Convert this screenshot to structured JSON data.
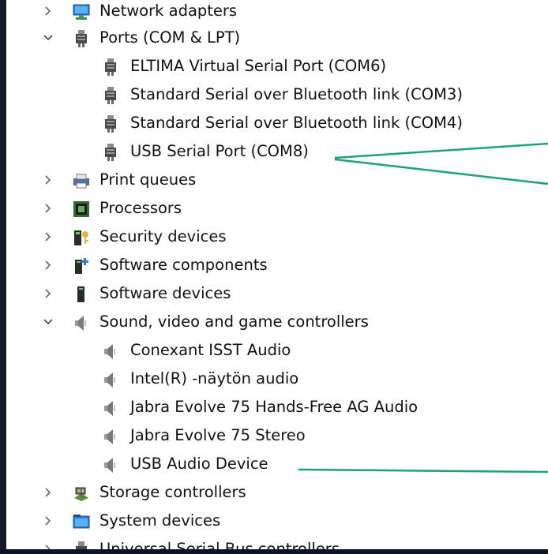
{
  "tree": {
    "items": [
      {
        "label": "Network adapters",
        "level": 0,
        "state": "collapsed",
        "icon": "network-adapter-icon"
      },
      {
        "label": "Ports (COM & LPT)",
        "level": 0,
        "state": "expanded",
        "icon": "port-icon"
      },
      {
        "label": "ELTIMA Virtual Serial Port (COM6)",
        "level": 1,
        "icon": "port-icon"
      },
      {
        "label": "Standard Serial over Bluetooth link (COM3)",
        "level": 1,
        "icon": "port-icon"
      },
      {
        "label": "Standard Serial over Bluetooth link (COM4)",
        "level": 1,
        "icon": "port-icon"
      },
      {
        "label": "USB Serial Port (COM8)",
        "level": 1,
        "icon": "port-icon"
      },
      {
        "label": "Print queues",
        "level": 0,
        "state": "collapsed",
        "icon": "printer-icon"
      },
      {
        "label": "Processors",
        "level": 0,
        "state": "collapsed",
        "icon": "processor-icon"
      },
      {
        "label": "Security devices",
        "level": 0,
        "state": "collapsed",
        "icon": "security-key-icon"
      },
      {
        "label": "Software components",
        "level": 0,
        "state": "collapsed",
        "icon": "software-component-icon"
      },
      {
        "label": "Software devices",
        "level": 0,
        "state": "collapsed",
        "icon": "software-device-icon"
      },
      {
        "label": "Sound, video and game controllers",
        "level": 0,
        "state": "expanded",
        "icon": "speaker-icon"
      },
      {
        "label": "Conexant ISST Audio",
        "level": 1,
        "icon": "speaker-icon"
      },
      {
        "label": "Intel(R) -näytön audio",
        "level": 1,
        "icon": "speaker-icon"
      },
      {
        "label": "Jabra Evolve 75 Hands-Free AG Audio",
        "level": 1,
        "icon": "speaker-icon"
      },
      {
        "label": "Jabra Evolve 75 Stereo",
        "level": 1,
        "icon": "speaker-icon"
      },
      {
        "label": "USB Audio Device",
        "level": 1,
        "icon": "speaker-icon"
      },
      {
        "label": "Storage controllers",
        "level": 0,
        "state": "collapsed",
        "icon": "storage-controller-icon"
      },
      {
        "label": "System devices",
        "level": 0,
        "state": "collapsed",
        "icon": "system-device-icon"
      },
      {
        "label": "Universal Serial Bus controllers",
        "level": 0,
        "state": "collapsed",
        "icon": "usb-controller-icon"
      }
    ]
  },
  "colors": {
    "callout": "#1aa37a",
    "background": "#101a2c",
    "panel": "#ffffff"
  }
}
